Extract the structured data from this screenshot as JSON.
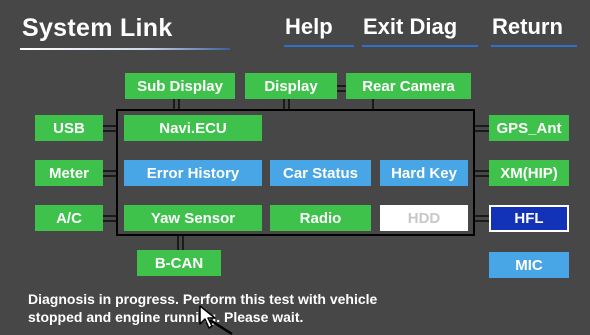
{
  "header": {
    "title": "System Link",
    "help_label": "Help",
    "exit_label": "Exit Diag",
    "return_label": "Return"
  },
  "units": {
    "sub_display": "Sub Display",
    "display": "Display",
    "rear_camera": "Rear Camera",
    "usb": "USB",
    "meter": "Meter",
    "ac": "A/C",
    "navi_ecu": "Navi.ECU",
    "error_history": "Error History",
    "car_status": "Car Status",
    "hard_key": "Hard Key",
    "yaw_sensor": "Yaw Sensor",
    "radio": "Radio",
    "hdd": "HDD",
    "gps_ant": "GPS_Ant",
    "xm_hip": "XM(HIP)",
    "hfl": "HFL",
    "mic": "MIC",
    "b_can": "B-CAN"
  },
  "status": {
    "line1": "Diagnosis in progress. Perform this test with vehicle",
    "line2": "stopped and engine running. Please wait."
  },
  "colors": {
    "background": "#474747",
    "unit_green": "#3ec24b",
    "unit_blue": "#49a6e6",
    "unit_disabled": "#ffffff",
    "unit_selected": "#1233b7",
    "header_underline": "#2f6fd0"
  },
  "icons": {
    "cursor": "mouse-pointer-icon"
  }
}
